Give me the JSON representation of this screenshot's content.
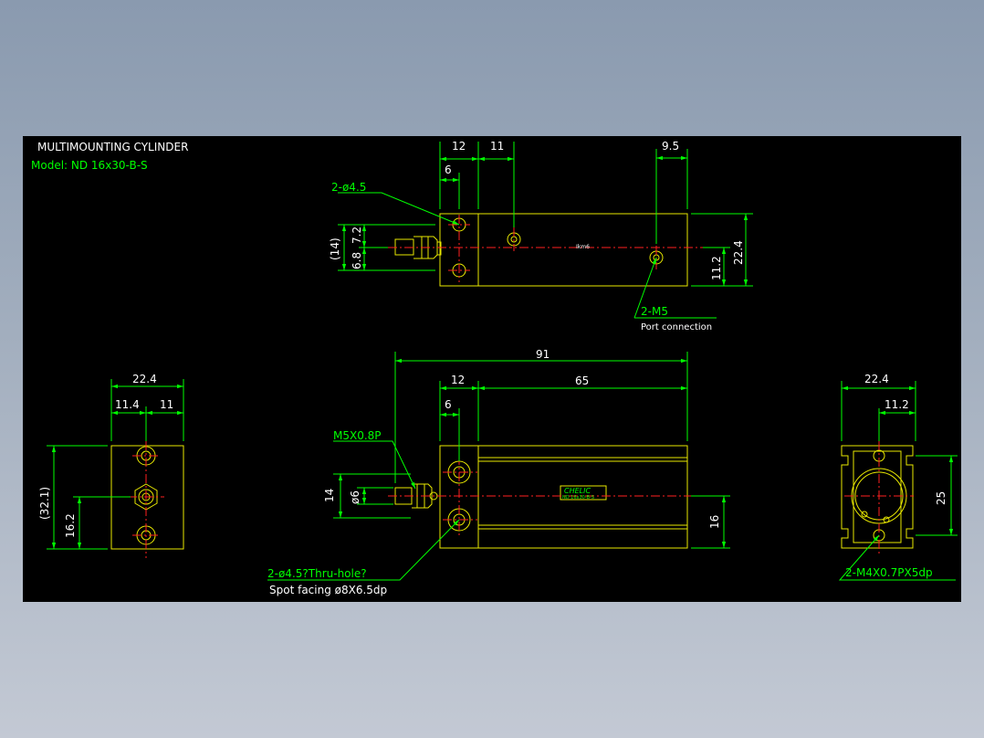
{
  "title_block": {
    "title": "MULTIMOUNTING CYLINDER",
    "model": "Model: ND 16x30-B-S"
  },
  "top_view": {
    "dims": {
      "d12": "12",
      "d11": "11",
      "d9_5": "9.5",
      "d6": "6",
      "d14p": "(14)",
      "d6_8": "6.8",
      "d7_2": "7.2",
      "d22_4": "22.4",
      "d11_2": "11.2"
    },
    "labels": {
      "holes": "2-ø4.5",
      "port": "2-M5",
      "port_note": "Port connection",
      "logo_small": "Ikm6"
    }
  },
  "front_view": {
    "dims": {
      "d91": "91",
      "d12": "12",
      "d65": "65",
      "d6": "6",
      "d14": "14",
      "d6dia": "ø6",
      "d16": "16"
    },
    "labels": {
      "thread": "M5X0.8P",
      "holes": "2-ø4.5?Thru-hole?",
      "spot": "Spot facing  ø8X6.5dp",
      "brand": "CHELIC",
      "brand_sub": "ND 16x30-B-S"
    }
  },
  "left_view": {
    "dims": {
      "d22_4": "22.4",
      "d11_4": "11.4",
      "d11": "11",
      "d32_1": "(32.1)",
      "d16_2": "16.2"
    }
  },
  "right_view": {
    "dims": {
      "d22_4": "22.4",
      "d11_2": "11.2",
      "d25": "25"
    },
    "labels": {
      "tap": "2-M4X0.7PX5dp"
    }
  },
  "colors": {
    "background": "#000000",
    "part_outline": "#e8e800",
    "dimension": "#00ff00",
    "text": "#ffffff",
    "centerline": "#ff2020"
  }
}
